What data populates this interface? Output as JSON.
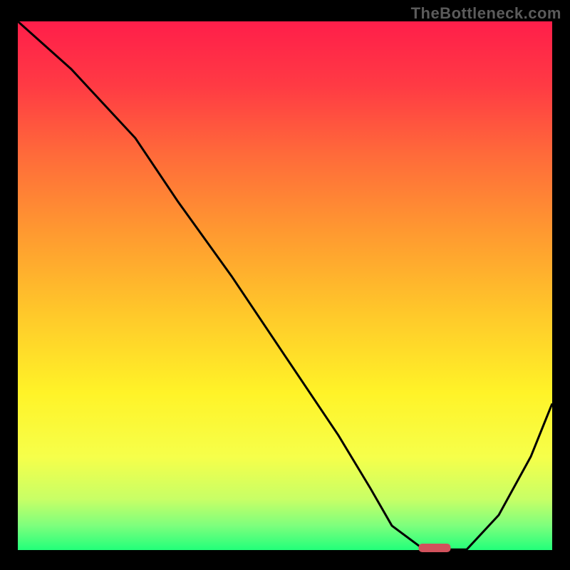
{
  "watermark": "TheBottleneck.com",
  "chart_data": {
    "type": "line",
    "title": "",
    "xlabel": "",
    "ylabel": "",
    "xlim": [
      0,
      100
    ],
    "ylim": [
      0,
      100
    ],
    "grid": false,
    "series": [
      {
        "name": "curve",
        "x": [
          0,
          10,
          22,
          30,
          40,
          50,
          60,
          66,
          70,
          76,
          80,
          84,
          90,
          96,
          100
        ],
        "y": [
          100,
          91,
          78,
          66,
          52,
          37,
          22,
          12,
          5,
          0.5,
          0.5,
          0.5,
          7,
          18,
          28
        ]
      }
    ],
    "marker": {
      "name": "optimal-marker",
      "x_center": 78,
      "y": 0.8,
      "width_pct": 6,
      "color": "#d1525c"
    },
    "gradient_stops": [
      {
        "offset": 0.0,
        "color": "#ff1e4a"
      },
      {
        "offset": 0.12,
        "color": "#ff3a44"
      },
      {
        "offset": 0.25,
        "color": "#ff6a3a"
      },
      {
        "offset": 0.4,
        "color": "#ff9a30"
      },
      {
        "offset": 0.55,
        "color": "#ffc82a"
      },
      {
        "offset": 0.7,
        "color": "#fff328"
      },
      {
        "offset": 0.82,
        "color": "#f6ff4a"
      },
      {
        "offset": 0.9,
        "color": "#c8ff66"
      },
      {
        "offset": 0.95,
        "color": "#7dff7d"
      },
      {
        "offset": 1.0,
        "color": "#1aff7a"
      }
    ],
    "curve_color": "#000000",
    "curve_width": 3,
    "baseline_color": "#000000",
    "baseline_width": 4
  }
}
